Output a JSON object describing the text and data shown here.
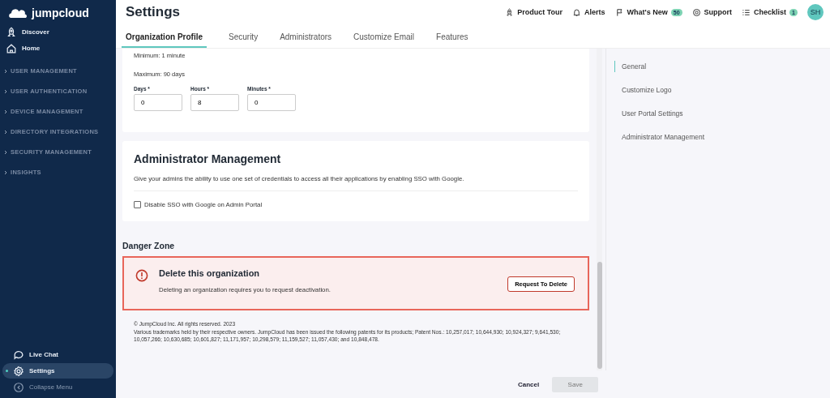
{
  "sidebar": {
    "brand": "jumpcloud",
    "top_items": [
      {
        "label": "Discover"
      },
      {
        "label": "Home"
      }
    ],
    "sections": [
      {
        "label": "USER MANAGEMENT"
      },
      {
        "label": "USER AUTHENTICATION"
      },
      {
        "label": "DEVICE MANAGEMENT"
      },
      {
        "label": "DIRECTORY INTEGRATIONS"
      },
      {
        "label": "SECURITY MANAGEMENT"
      },
      {
        "label": "INSIGHTS"
      }
    ],
    "bottom_items": [
      {
        "label": "Live Chat",
        "selected": false,
        "muted": false
      },
      {
        "label": "Settings",
        "selected": true,
        "muted": false
      },
      {
        "label": "Collapse Menu",
        "selected": false,
        "muted": true
      }
    ]
  },
  "header": {
    "title": "Settings",
    "links": [
      {
        "label": "Product Tour"
      },
      {
        "label": "Alerts"
      },
      {
        "label": "What's New",
        "badge": "50"
      },
      {
        "label": "Support"
      },
      {
        "label": "Checklist",
        "badge": "1"
      }
    ],
    "avatar": "SH"
  },
  "tabs": [
    {
      "label": "Organization Profile",
      "selected": true
    },
    {
      "label": "Security",
      "selected": false
    },
    {
      "label": "Administrators",
      "selected": false
    },
    {
      "label": "Customize Email",
      "selected": false
    },
    {
      "label": "Features",
      "selected": false
    }
  ],
  "session_card": {
    "minimum": "Minimum: 1 minute",
    "maximum": "Maximum: 90 days",
    "fields": [
      {
        "label": "Days *",
        "value": "0"
      },
      {
        "label": "Hours *",
        "value": "8"
      },
      {
        "label": "Minutes *",
        "value": "0"
      }
    ]
  },
  "admin_card": {
    "title": "Administrator Management",
    "description": "Give your admins the ability to use one set of credentials to access all their applications by enabling SSO with Google.",
    "checkbox": {
      "label": "Disable SSO with Google on Admin Portal",
      "checked": false
    }
  },
  "danger_zone": {
    "heading": "Danger Zone",
    "title": "Delete this organization",
    "description": "Deleting an organization requires you to request deactivation.",
    "button": "Request To Delete"
  },
  "legal": {
    "copyright": "© JumpCloud Inc. All rights reserved. 2023",
    "patents": "Various trademarks held by their respective owners. JumpCloud has been issued the following patents for its products; Patent Nos.: 10,257,017; 10,644,930; 10,924,327; 9,641,530; 10,057,266; 10,630,685; 10,601,827; 11,171,957; 10,298,579; 11,159,527; 11,057,430; and 10,848,478."
  },
  "right_nav": [
    {
      "label": "General",
      "selected": true
    },
    {
      "label": "Customize Logo",
      "selected": false
    },
    {
      "label": "User Portal Settings",
      "selected": false
    },
    {
      "label": "Administrator Management",
      "selected": false
    }
  ],
  "footer": {
    "cancel": "Cancel",
    "save": {
      "label": "Save",
      "disabled": true
    }
  }
}
